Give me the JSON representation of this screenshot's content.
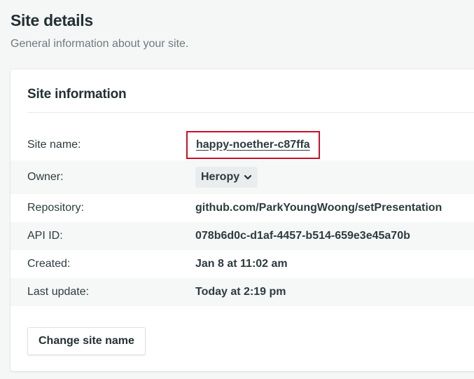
{
  "header": {
    "title": "Site details",
    "subtitle": "General information about your site."
  },
  "card": {
    "title": "Site information",
    "rows": [
      {
        "label": "Site name:",
        "value": "happy-noether-c87ffa"
      },
      {
        "label": "Owner:",
        "value": "Heropy"
      },
      {
        "label": "Repository:",
        "value": "github.com/ParkYoungWoong/setPresentation"
      },
      {
        "label": "API ID:",
        "value": "078b6d0c-d1af-4457-b514-659e3e45a70b"
      },
      {
        "label": "Created:",
        "value": "Jan 8 at 11:02 am"
      },
      {
        "label": "Last update:",
        "value": "Today at 2:19 pm"
      }
    ],
    "change_button_label": "Change site name"
  },
  "icons": {
    "owner_dropdown": "chevron-down-icon"
  },
  "colors": {
    "highlight_border": "#c9102a",
    "background": "#f5f7f7",
    "card": "#ffffff",
    "row_stripe": "#f6f8f8"
  }
}
